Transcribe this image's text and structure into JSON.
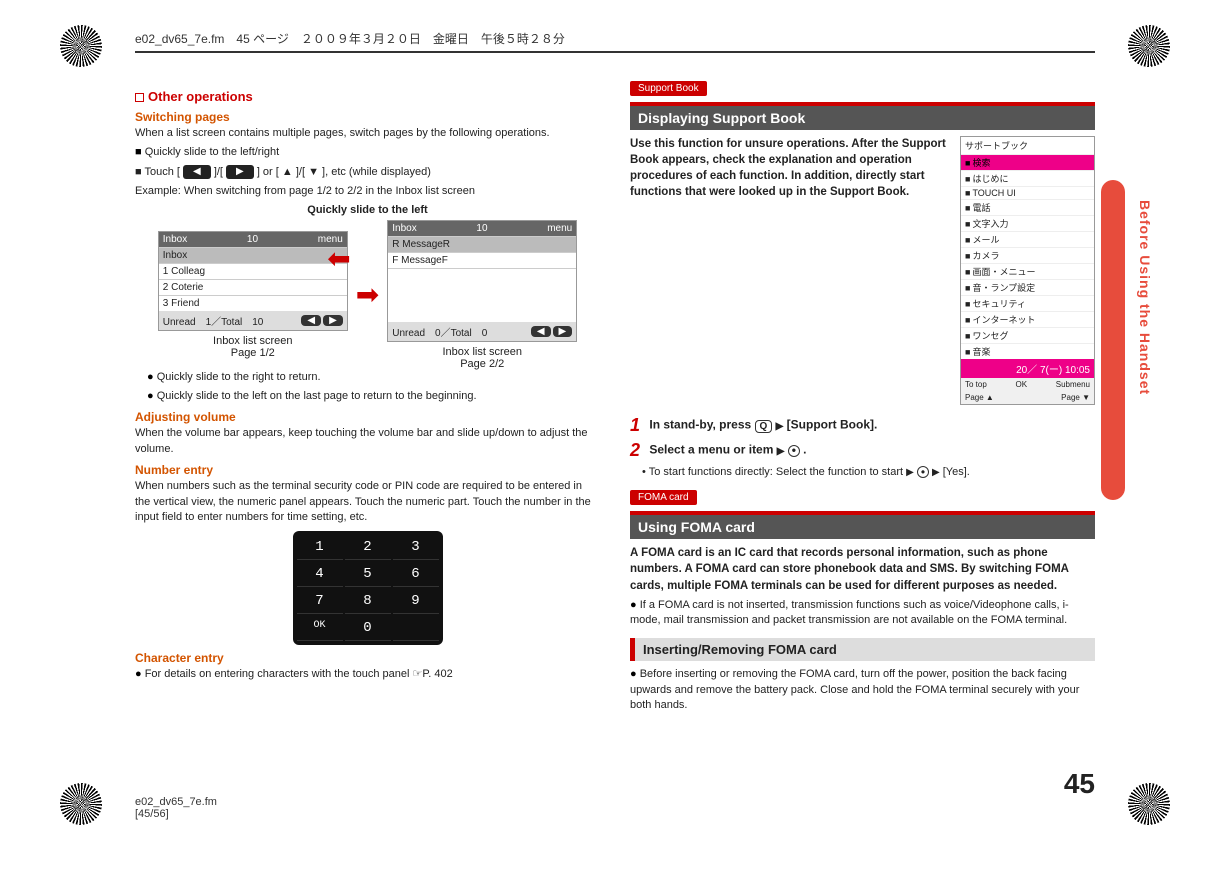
{
  "header": "e02_dv65_7e.fm　45 ページ　２００９年３月２０日　金曜日　午後５時２８分",
  "side_tab": "Before Using the Handset",
  "left": {
    "other_ops_heading": "Other operations",
    "switching_pages": {
      "title": "Switching pages",
      "intro": "When a list screen contains multiple pages, switch pages by the following operations.",
      "b1": "Quickly slide to the left/right",
      "b2_pre": "Touch [",
      "b2_mid": "]/[",
      "b2_post": "] or [",
      "b2_or": "]/[",
      "b2_end": "], etc (while displayed)",
      "example": "Example: When switching from page 1/2 to 2/2 in the Inbox list screen",
      "slide_caption": "Quickly slide to the left",
      "shot1": {
        "title": "Inbox",
        "count": "10",
        "menu": "menu",
        "rows": [
          "Inbox",
          "Colleag",
          "Coterie",
          "Friend"
        ],
        "unread": "Unread　1／Total　10",
        "caption": "Inbox list screen",
        "page": "Page 1/2"
      },
      "shot2": {
        "title": "Inbox",
        "count": "10",
        "menu": "menu",
        "rows": [
          "MessageR",
          "MessageF"
        ],
        "unread": "Unread　0／Total　0",
        "caption": "Inbox list screen",
        "page": "Page 2/2"
      },
      "n1": "Quickly slide to the right to return.",
      "n2": "Quickly slide to the left on the last page to return to the beginning."
    },
    "adjusting_volume": {
      "title": "Adjusting volume",
      "text": "When the volume bar appears, keep touching the volume bar and slide up/down to adjust the volume."
    },
    "number_entry": {
      "title": "Number entry",
      "text": "When numbers such as the terminal security code or PIN code are required to be entered in the vertical view, the numeric panel appears. Touch the numeric part. Touch the number in the input field to enter numbers for time setting, etc.",
      "keys": [
        "1",
        "2",
        "3",
        "4",
        "5",
        "6",
        "7",
        "8",
        "9",
        "OK",
        "0",
        ""
      ]
    },
    "character_entry": {
      "title": "Character entry",
      "text": "For details on entering characters with the touch panel ☞P. 402"
    }
  },
  "right": {
    "support_book": {
      "tag": "Support Book",
      "band": "Displaying Support Book",
      "lead": "Use this function for unsure operations. After the Support Book appears, check the explanation and operation procedures of each function. In addition, directly start functions that were looked up in the Support Book.",
      "thumb": {
        "title": "サポートブック",
        "rows": [
          "検索",
          "はじめに",
          "TOUCH UI",
          "電話",
          "文字入力",
          "メール",
          "カメラ",
          "画面・メニュー",
          "音・ランプ設定",
          "セキュリティ",
          "インターネット",
          "ワンセグ",
          "音楽"
        ],
        "hl_index": 0,
        "time": "20／ 7(ー) 10:05",
        "foot": [
          "To top",
          "OK",
          "Submenu"
        ],
        "pager": [
          "Page ▲",
          "",
          "Page ▼"
        ]
      },
      "step1": "In stand-by, press ",
      "step1_key": "Q",
      "step1_tail": "[Support Book].",
      "step2": "Select a menu or item",
      "step2_dot": ".",
      "step2_note": "To start functions directly: Select the function to start",
      "step2_tail": "[Yes]."
    },
    "foma": {
      "tag": "FOMA card",
      "band": "Using FOMA card",
      "lead": "A FOMA card is an IC card that records personal information, such as phone numbers. A FOMA card can store phonebook data and SMS. By switching FOMA cards, multiple FOMA terminals can be used for different purposes as needed.",
      "b1": "If a FOMA card is not inserted, transmission functions such as voice/Videophone calls, i-mode, mail transmission and packet transmission are not available on the FOMA terminal.",
      "sub": "Inserting/Removing FOMA card",
      "b2": "Before inserting or removing the FOMA card, turn off the power, position the back facing upwards and remove the battery pack. Close and hold the FOMA terminal securely with your both hands."
    }
  },
  "page_number": "45",
  "footer": {
    "l1": "e02_dv65_7e.fm",
    "l2": "[45/56]"
  }
}
